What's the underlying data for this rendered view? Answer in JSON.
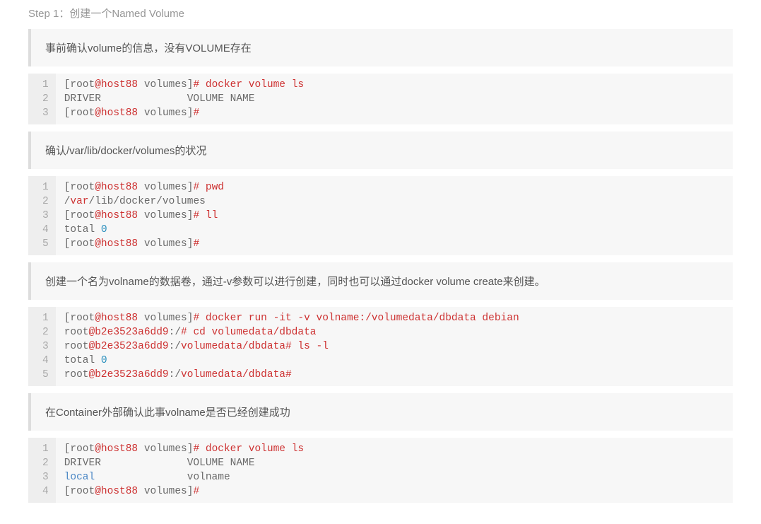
{
  "heading": "Step 1：创建一个Named Volume",
  "notes": {
    "n1": "事前确认volume的信息，没有VOLUME存在",
    "n2": "确认/var/lib/docker/volumes的状况",
    "n3": "创建一个名为volname的数据卷，通过-v参数可以进行创建，同时也可以通过docker volume create来创建。",
    "n4": "在Container外部确认此事volname是否已经创建成功"
  },
  "blocks": {
    "b1": {
      "numbers": [
        "1",
        "2",
        "3"
      ],
      "lines": [
        [
          {
            "c": "tk-gray",
            "t": "["
          },
          {
            "c": "tk-gray",
            "t": "root"
          },
          {
            "c": "tk-cmd",
            "t": "@host88"
          },
          {
            "c": "tk-gray",
            "t": " volumes]"
          },
          {
            "c": "tk-hash",
            "t": "# docker volume ls"
          }
        ],
        [
          {
            "c": "tk-kw",
            "t": "DRIVER              VOLUME NAME"
          }
        ],
        [
          {
            "c": "tk-gray",
            "t": "["
          },
          {
            "c": "tk-gray",
            "t": "root"
          },
          {
            "c": "tk-cmd",
            "t": "@host88"
          },
          {
            "c": "tk-gray",
            "t": " volumes]"
          },
          {
            "c": "tk-hash",
            "t": "#"
          }
        ]
      ]
    },
    "b2": {
      "numbers": [
        "1",
        "2",
        "3",
        "4",
        "5"
      ],
      "lines": [
        [
          {
            "c": "tk-gray",
            "t": "["
          },
          {
            "c": "tk-gray",
            "t": "root"
          },
          {
            "c": "tk-cmd",
            "t": "@host88"
          },
          {
            "c": "tk-gray",
            "t": " volumes]"
          },
          {
            "c": "tk-hash",
            "t": "# pwd"
          }
        ],
        [
          {
            "c": "tk-slash",
            "t": "/"
          },
          {
            "c": "tk-cmd",
            "t": "var"
          },
          {
            "c": "tk-slash",
            "t": "/"
          },
          {
            "c": "tk-gray",
            "t": "lib/docker/volumes"
          }
        ],
        [
          {
            "c": "tk-gray",
            "t": "["
          },
          {
            "c": "tk-gray",
            "t": "root"
          },
          {
            "c": "tk-cmd",
            "t": "@host88"
          },
          {
            "c": "tk-gray",
            "t": " volumes]"
          },
          {
            "c": "tk-hash",
            "t": "# ll"
          }
        ],
        [
          {
            "c": "tk-gray",
            "t": "total "
          },
          {
            "c": "tk-num",
            "t": "0"
          }
        ],
        [
          {
            "c": "tk-gray",
            "t": "["
          },
          {
            "c": "tk-gray",
            "t": "root"
          },
          {
            "c": "tk-cmd",
            "t": "@host88"
          },
          {
            "c": "tk-gray",
            "t": " volumes]"
          },
          {
            "c": "tk-hash",
            "t": "#"
          }
        ]
      ]
    },
    "b3": {
      "numbers": [
        "1",
        "2",
        "3",
        "4",
        "5"
      ],
      "lines": [
        [
          {
            "c": "tk-gray",
            "t": "["
          },
          {
            "c": "tk-gray",
            "t": "root"
          },
          {
            "c": "tk-cmd",
            "t": "@host88"
          },
          {
            "c": "tk-gray",
            "t": " volumes]"
          },
          {
            "c": "tk-hash",
            "t": "# docker run -it -v volname:/volumedata/dbdata debian"
          }
        ],
        [
          {
            "c": "tk-gray",
            "t": "root"
          },
          {
            "c": "tk-cmd",
            "t": "@b2e3523a6dd9"
          },
          {
            "c": "tk-slash",
            "t": ":/"
          },
          {
            "c": "tk-hash",
            "t": "# cd volumedata/dbdata"
          }
        ],
        [
          {
            "c": "tk-gray",
            "t": "root"
          },
          {
            "c": "tk-cmd",
            "t": "@b2e3523a6dd9"
          },
          {
            "c": "tk-slash",
            "t": ":/"
          },
          {
            "c": "tk-path",
            "t": "volumedata/dbdata"
          },
          {
            "c": "tk-hash",
            "t": "# ls -l"
          }
        ],
        [
          {
            "c": "tk-gray",
            "t": "total "
          },
          {
            "c": "tk-num",
            "t": "0"
          }
        ],
        [
          {
            "c": "tk-gray",
            "t": "root"
          },
          {
            "c": "tk-cmd",
            "t": "@b2e3523a6dd9"
          },
          {
            "c": "tk-slash",
            "t": ":/"
          },
          {
            "c": "tk-path",
            "t": "volumedata/dbdata"
          },
          {
            "c": "tk-hash",
            "t": "#"
          }
        ]
      ]
    },
    "b4": {
      "numbers": [
        "1",
        "2",
        "3",
        "4"
      ],
      "lines": [
        [
          {
            "c": "tk-gray",
            "t": "["
          },
          {
            "c": "tk-gray",
            "t": "root"
          },
          {
            "c": "tk-cmd",
            "t": "@host88"
          },
          {
            "c": "tk-gray",
            "t": " volumes]"
          },
          {
            "c": "tk-hash",
            "t": "# docker volume ls"
          }
        ],
        [
          {
            "c": "tk-gray",
            "t": "DRIVER              VOLUME NAME"
          }
        ],
        [
          {
            "c": "tk-local",
            "t": "local"
          },
          {
            "c": "tk-gray",
            "t": "               volname"
          }
        ],
        [
          {
            "c": "tk-gray",
            "t": "["
          },
          {
            "c": "tk-gray",
            "t": "root"
          },
          {
            "c": "tk-cmd",
            "t": "@host88"
          },
          {
            "c": "tk-gray",
            "t": " volumes]"
          },
          {
            "c": "tk-hash",
            "t": "#"
          }
        ]
      ]
    }
  }
}
